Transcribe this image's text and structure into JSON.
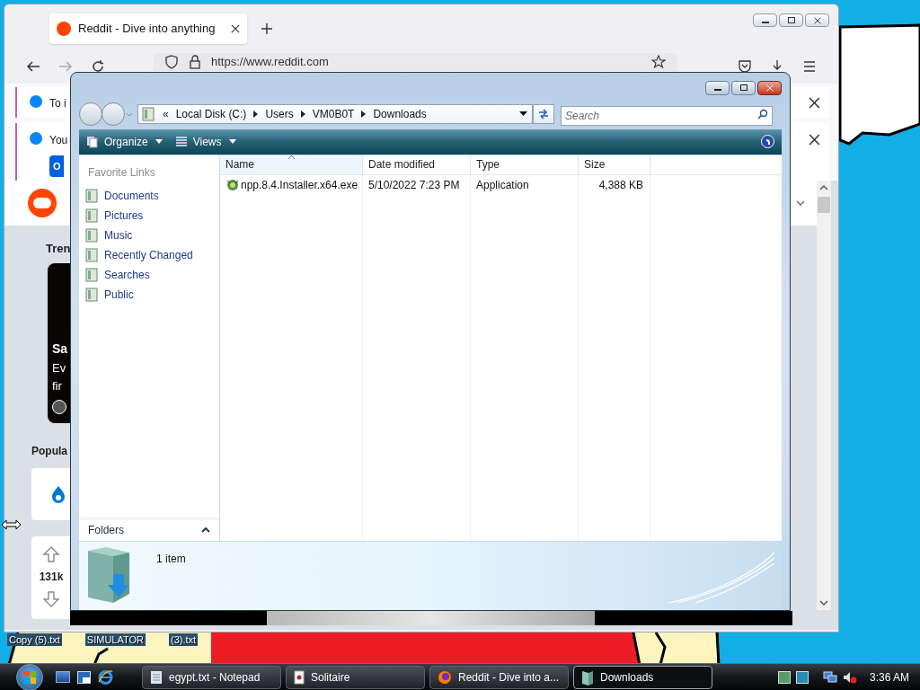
{
  "desktop": {
    "icons": [
      {
        "label": "Copy (5).txt"
      },
      {
        "label": "SIMULATOR"
      },
      {
        "label": "(3).txt"
      }
    ]
  },
  "browser": {
    "tabs": [
      {
        "title": "Reddit - Dive into anything",
        "selected": true
      }
    ],
    "url": "https://www.reddit.com",
    "notices": [
      {
        "text": "To i"
      },
      {
        "text": "You",
        "button": "O"
      }
    ],
    "page": {
      "trending": "Tren",
      "card": {
        "title": "Sa",
        "lines": [
          "Ev",
          "fir"
        ]
      },
      "popular": "Popula",
      "votes": "131k"
    }
  },
  "explorer": {
    "overflow": "«",
    "breadcrumb": [
      "Local Disk (C:)",
      "Users",
      "VM0B0T",
      "Downloads"
    ],
    "search": {
      "placeholder": "Search"
    },
    "toolbar": [
      "Organize",
      "Views"
    ],
    "favorites": {
      "title": "Favorite Links",
      "items": [
        {
          "label": "Documents"
        },
        {
          "label": "Pictures"
        },
        {
          "label": "Music"
        },
        {
          "label": "Recently Changed"
        },
        {
          "label": "Searches"
        },
        {
          "label": "Public"
        }
      ]
    },
    "folders": "Folders",
    "columns": [
      {
        "label": "Name",
        "sorted": true
      },
      {
        "label": "Date modified",
        "sorted": false
      },
      {
        "label": "Type",
        "sorted": false
      },
      {
        "label": "Size",
        "sorted": false
      }
    ],
    "rows": [
      {
        "name": "npp.8.4.Installer.x64.exe",
        "date": "5/10/2022 7:23 PM",
        "type": "Application",
        "size": "4,388 KB",
        "selected": false
      }
    ],
    "status": "1 item"
  },
  "taskbar": {
    "tasks": [
      {
        "label": "egypt.txt - Notepad",
        "kind": "notepad",
        "selected": false
      },
      {
        "label": "Solitaire",
        "kind": "cards",
        "selected": false
      },
      {
        "label": "Reddit - Dive into a...",
        "kind": "browser",
        "selected": false
      },
      {
        "label": "Downloads",
        "kind": "folder",
        "selected": true
      }
    ],
    "clock": "3:36 AM"
  }
}
